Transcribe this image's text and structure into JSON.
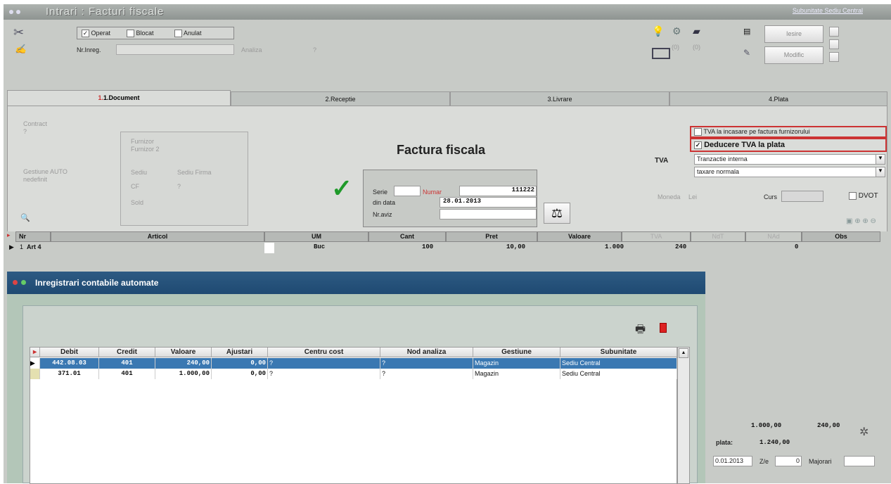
{
  "window": {
    "title": "Intrari : Facturi fiscale",
    "subunit_link": "Subunitate Sediu Central"
  },
  "toolbar": {
    "operat": "Operat",
    "blocat": "Blocat",
    "anulat": "Anulat",
    "nr_inreg_label": "Nr.Inreg.",
    "analiza_label": "Analiza",
    "analiza_value": "?",
    "count1": "(0)",
    "count2": "(0)",
    "iesire": "Iesire",
    "modific": "Modific"
  },
  "tabs": [
    {
      "label": "1.Document"
    },
    {
      "label": "2.Receptie"
    },
    {
      "label": "3.Livrare"
    },
    {
      "label": "4.Plata"
    }
  ],
  "doc": {
    "contract_label": "Contract",
    "contract_value": "?",
    "gestiune_label": "Gestiune AUTO",
    "gestiune_value": "nedefinit",
    "furnizor1": "Furnizor",
    "furnizor2": "Furnizor 2",
    "sediu_label": "Sediu",
    "sediu_value": "Sediu Firma",
    "cf_label": "CF",
    "cf_value": "?",
    "sold_label": "Sold",
    "title": "Factura fiscala",
    "serie_label": "Serie",
    "numar_label": "Numar",
    "numar_value": "111222",
    "din_data_label": "din data",
    "din_data_value": "28.01.2013",
    "nr_aviz_label": "Nr.aviz",
    "tva_label": "TVA",
    "tva_incasare": "TVA la incasare pe factura furnizorului",
    "deducere": "Deducere TVA la plata",
    "tranzactie": "Tranzactie interna",
    "taxare": "taxare normala",
    "moneda_label": "Moneda",
    "moneda_value": "Lei",
    "curs_label": "Curs",
    "dvot": "DVOT"
  },
  "articles": {
    "headers": [
      "Nr",
      "Articol",
      "UM",
      "Cant",
      "Pret",
      "Valoare",
      "TVA",
      "NdT",
      "NAd",
      "Obs"
    ],
    "rows": [
      {
        "nr": "1",
        "articol": "Art 4",
        "um": "Buc",
        "cant": "100",
        "pret": "10,00",
        "valoare": "1.000",
        "tva": "240",
        "obs": "0"
      }
    ]
  },
  "dialog": {
    "title": "Inregistrari contabile automate",
    "headers": [
      "Debit",
      "Credit",
      "Valoare",
      "Ajustari",
      "Centru cost",
      "Nod analiza",
      "Gestiune",
      "Subunitate"
    ],
    "rows": [
      {
        "debit": "442.08.03",
        "credit": "401",
        "valoare": "240,00",
        "ajustari": "0,00",
        "centru": "?",
        "nod": "?",
        "gestiune": "Magazin",
        "subunitate": "Sediu Central"
      },
      {
        "debit": "371.01",
        "credit": "401",
        "valoare": "1.000,00",
        "ajustari": "0,00",
        "centru": "?",
        "nod": "?",
        "gestiune": "Magazin",
        "subunitate": "Sediu Central"
      }
    ]
  },
  "totals": {
    "valoare": "1.000,00",
    "tva": "240,00",
    "plata_label": "plata:",
    "plata_value": "1.240,00",
    "date_partial": "0.01.2013",
    "zile_label": "Z/e",
    "zile_value": "0",
    "majorari_label": "Majorari"
  }
}
